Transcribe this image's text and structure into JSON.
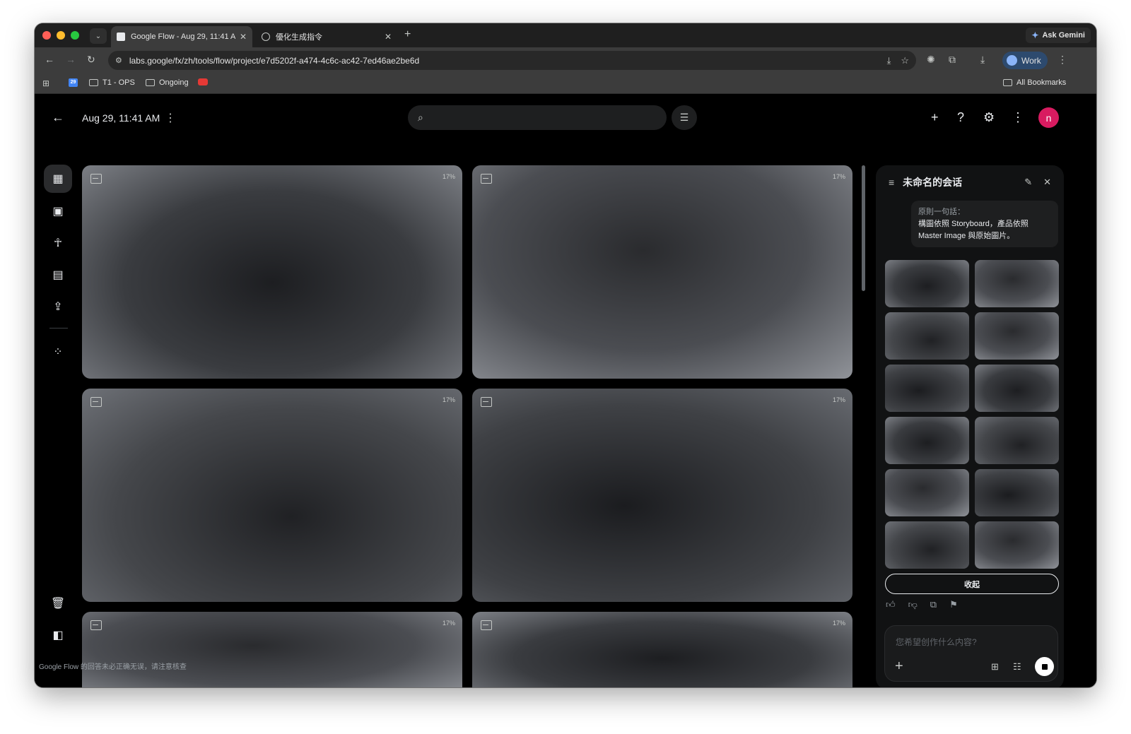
{
  "browser": {
    "tabs": [
      {
        "title": "Google Flow - Aug 29, 11:41 A",
        "close": "✕"
      },
      {
        "title": "優化生成指令",
        "close": "✕"
      }
    ],
    "new_tab": "+",
    "ask_gemini": "Ask Gemini",
    "url": "labs.google/fx/zh/tools/flow/project/e7d5202f-a474-4c6c-ac42-7ed46ae2be6d",
    "profile_label": "Work",
    "bookmarks": [
      {
        "label": "T1 - OPS"
      },
      {
        "label": "Ongoing"
      }
    ],
    "calendar_day": "29",
    "all_bookmarks": "All Bookmarks"
  },
  "app": {
    "project_title": "Aug 29, 11:41 AM",
    "avatar_letter": "n",
    "search_placeholder": "",
    "disclaimer": "Google Flow 的回答未必正确无误，请注意核查"
  },
  "grid": {
    "cards": [
      {
        "progress": "17%"
      },
      {
        "progress": "17%"
      },
      {
        "progress": "17%"
      },
      {
        "progress": "17%"
      },
      {
        "progress": "17%"
      },
      {
        "progress": "17%"
      }
    ]
  },
  "chat": {
    "title": "未命名的会话",
    "quote_line1": "原則一句話：",
    "quote_line2": "構圖依照 Storyboard，產品依照 Master Image 與原始圖片。",
    "collapse_label": "收起",
    "composer_placeholder": "您希望创作什么内容?"
  },
  "icons": {
    "back": "arrow-left-icon",
    "search": "search-icon",
    "filter": "filter-icon",
    "add": "plus-icon",
    "help": "help-icon",
    "settings": "gear-icon",
    "more": "more-vert-icon"
  },
  "colors": {
    "avatar": "#d81b60",
    "app_background": "#000000",
    "panel_background": "#111213"
  }
}
